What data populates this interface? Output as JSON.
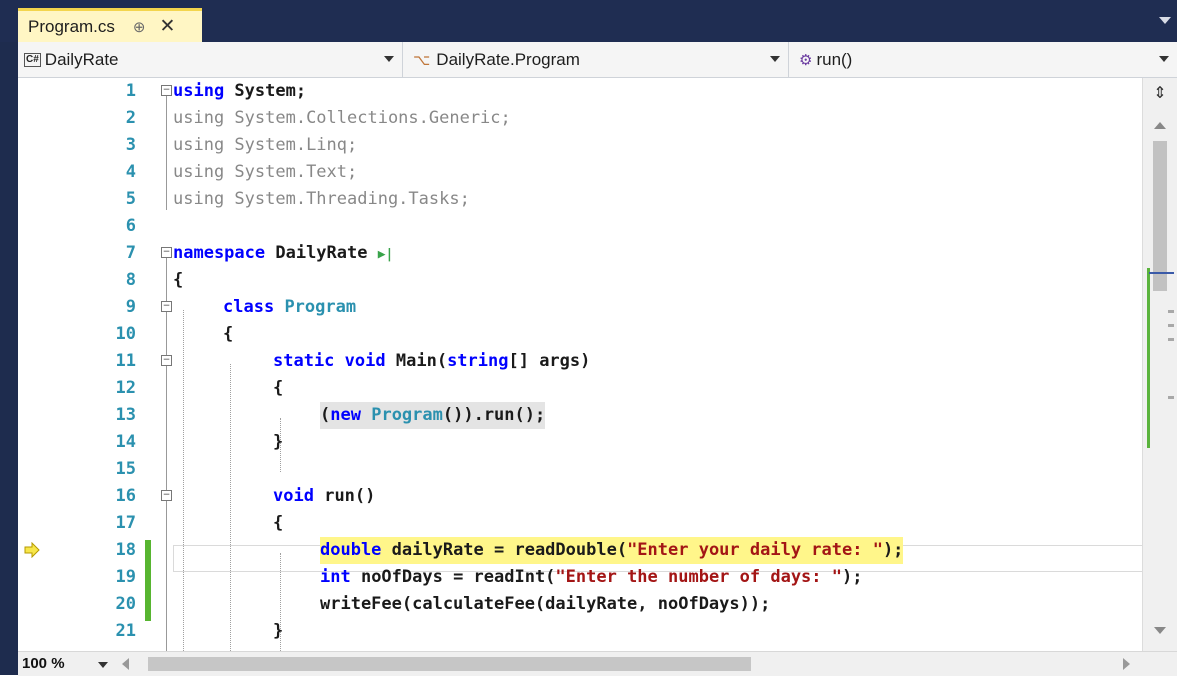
{
  "tab": {
    "filename": "Program.cs",
    "pin_glyph": "⊕",
    "close_glyph": "✕"
  },
  "navbar": {
    "project": "DailyRate",
    "project_badge": "C#",
    "class": "DailyRate.Program",
    "member": "run()"
  },
  "editor": {
    "line_numbers": [
      "1",
      "2",
      "3",
      "4",
      "5",
      "6",
      "7",
      "8",
      "9",
      "10",
      "11",
      "12",
      "13",
      "14",
      "15",
      "16",
      "17",
      "18",
      "19",
      "20",
      "21"
    ],
    "lines": {
      "l1": {
        "kw": "using",
        "rest": " System;"
      },
      "l2": {
        "kw": "using",
        "rest": " System.Collections.Generic;"
      },
      "l3": {
        "kw": "using",
        "rest": " System.Linq;"
      },
      "l4": {
        "kw": "using",
        "rest": " System.Text;"
      },
      "l5": {
        "kw": "using",
        "rest": " System.Threading.Tasks;"
      },
      "l7": {
        "kw": "namespace",
        "rest": " DailyRate",
        "marker": "▶|"
      },
      "l8": {
        "text": "{"
      },
      "l9": {
        "kw": "class",
        "type": "Program"
      },
      "l10": {
        "text": "{"
      },
      "l11": {
        "kw1": "static",
        "kw2": "void",
        "name": "Main(",
        "kw3": "string",
        "rest": "[] args)"
      },
      "l12": {
        "text": "{"
      },
      "l13": {
        "open": "(",
        "kw": "new",
        "type": "Program",
        "rest": "()).run();"
      },
      "l14": {
        "text": "}"
      },
      "l16": {
        "kw": "void",
        "rest": "run()"
      },
      "l17": {
        "text": "{"
      },
      "l18": {
        "kw": "double",
        "rest": " dailyRate = readDouble(",
        "str": "\"Enter your daily rate: \"",
        "end": ");"
      },
      "l19": {
        "kw": "int",
        "rest": " noOfDays = readInt(",
        "str": "\"Enter the number of days: \"",
        "end": ");"
      },
      "l20": {
        "text": "writeFee(calculateFee(dailyRate, noOfDays));"
      },
      "l21": {
        "text": "}"
      }
    }
  },
  "statusbar": {
    "zoom": "100 %"
  },
  "colors": {
    "tab_active": "#fff6c4",
    "frame": "#1f2d52",
    "keyword": "#0000ff",
    "type": "#2b91af",
    "string": "#a31515",
    "change_bar": "#57b530",
    "current_line": "#fff68a"
  },
  "icons": [
    "pin-icon",
    "close-icon",
    "csharp-project-icon",
    "class-icon",
    "method-icon",
    "execution-arrow-icon",
    "split-icon"
  ]
}
